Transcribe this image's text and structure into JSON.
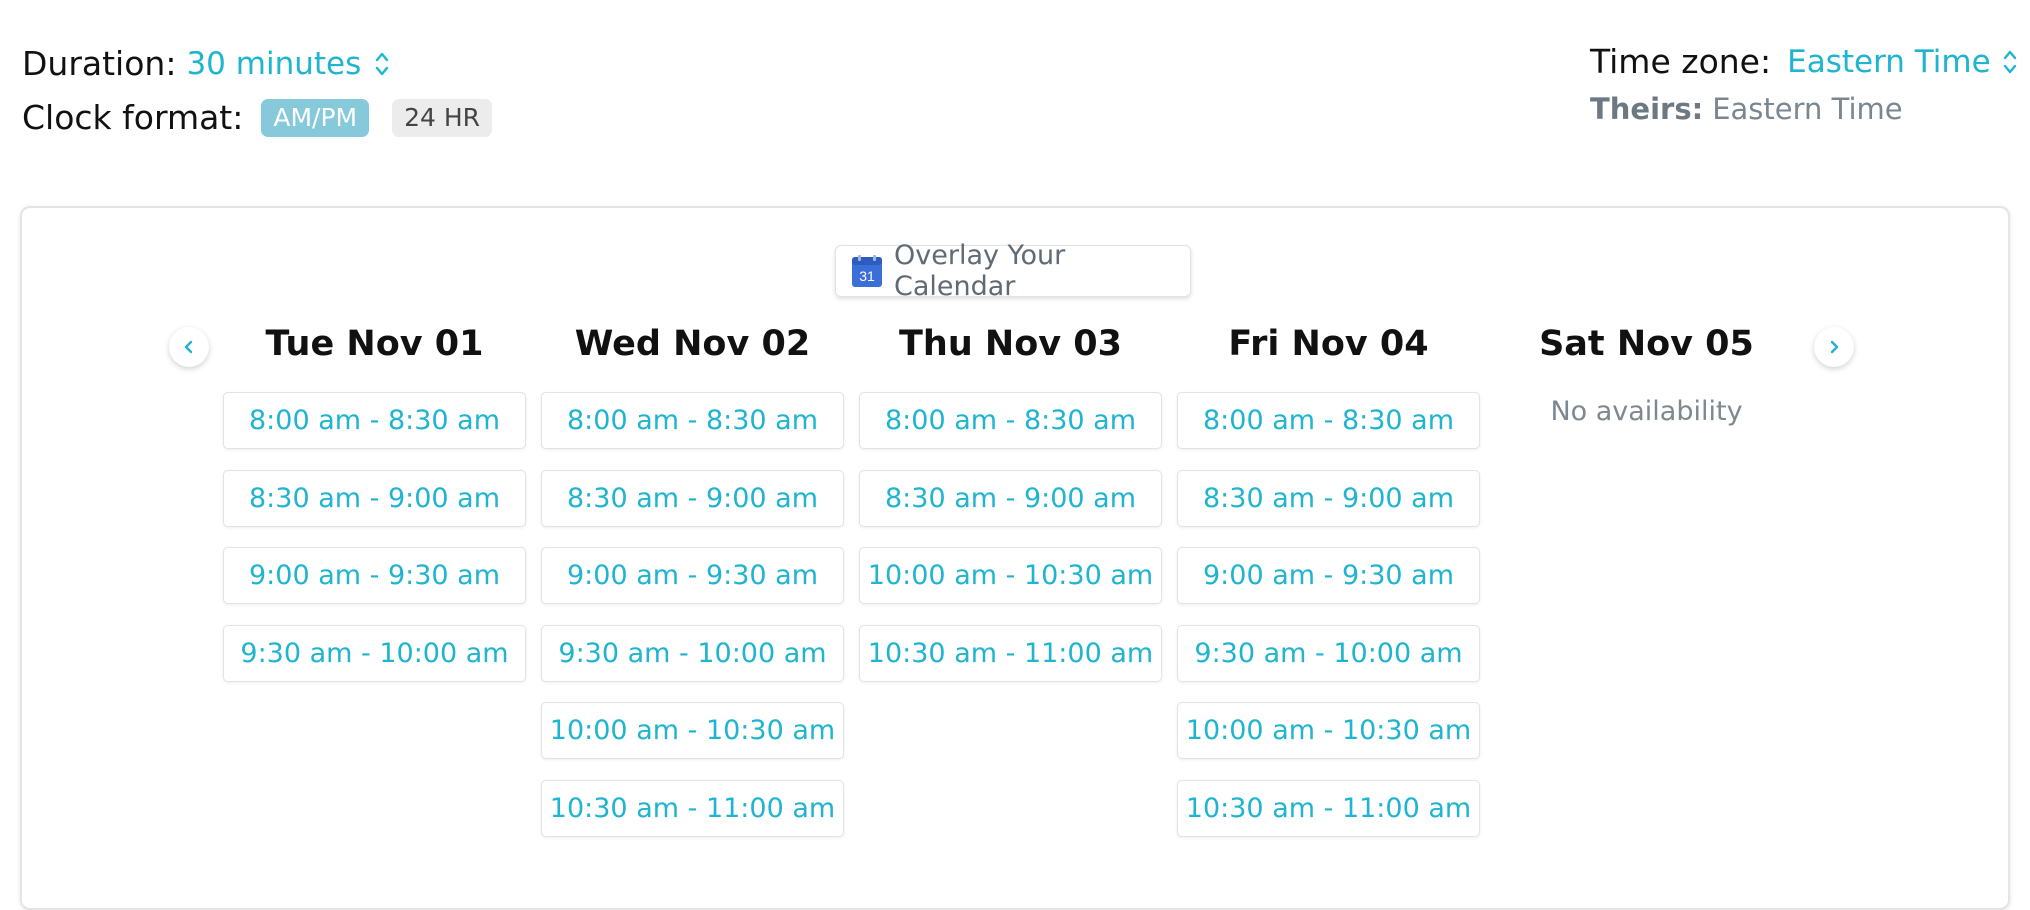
{
  "header": {
    "duration_label": "Duration:",
    "duration_value": "30 minutes",
    "clock_label": "Clock format:",
    "clock_options": [
      "AM/PM",
      "24 HR"
    ],
    "clock_selected": "AM/PM",
    "timezone_label": "Time zone:",
    "timezone_value": "Eastern Time",
    "theirs_label": "Theirs:",
    "theirs_value": "Eastern Time"
  },
  "overlay_button": {
    "label": "Overlay Your Calendar",
    "icon": "google-calendar-icon",
    "icon_text": "31"
  },
  "colors": {
    "accent": "#1fb4cf",
    "pill_active": "#86c9db",
    "pill_inactive": "#ececec",
    "muted_text": "#7d8890"
  },
  "calendar": {
    "prev_icon": "chevron-left-icon",
    "next_icon": "chevron-right-icon",
    "days": [
      {
        "title": "Tue Nov 01",
        "slots": [
          "8:00 am - 8:30 am",
          "8:30 am - 9:00 am",
          "9:00 am - 9:30 am",
          "9:30 am - 10:00 am"
        ]
      },
      {
        "title": "Wed Nov 02",
        "slots": [
          "8:00 am - 8:30 am",
          "8:30 am - 9:00 am",
          "9:00 am - 9:30 am",
          "9:30 am - 10:00 am",
          "10:00 am - 10:30 am",
          "10:30 am - 11:00 am"
        ]
      },
      {
        "title": "Thu Nov 03",
        "slots": [
          "8:00 am - 8:30 am",
          "8:30 am - 9:00 am",
          "10:00 am - 10:30 am",
          "10:30 am - 11:00 am"
        ]
      },
      {
        "title": "Fri Nov 04",
        "slots": [
          "8:00 am - 8:30 am",
          "8:30 am - 9:00 am",
          "9:00 am - 9:30 am",
          "9:30 am - 10:00 am",
          "10:00 am - 10:30 am",
          "10:30 am - 11:00 am"
        ]
      },
      {
        "title": "Sat Nov 05",
        "slots": [],
        "empty_text": "No availability"
      }
    ]
  }
}
